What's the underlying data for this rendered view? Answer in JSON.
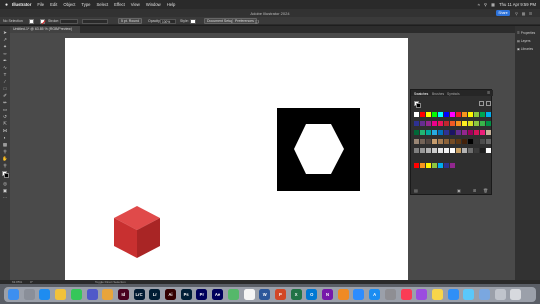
{
  "menubar": {
    "apple": "",
    "app_name": "Illustrator",
    "items": [
      "File",
      "Edit",
      "Object",
      "Type",
      "Select",
      "Effect",
      "View",
      "Window",
      "Help"
    ],
    "clock": "Thu 11 Apr 9:59 PM"
  },
  "appbar": {
    "title": "Adobe Illustrator 2024",
    "share_label": "Share"
  },
  "controlbar": {
    "selection_label": "No Selection",
    "stroke_label": "Stroke:",
    "opacity_label": "Opacity:",
    "opacity_value": "100%",
    "style_label": "Style:",
    "basic_label": "5 pt. Round",
    "doc_setup_label": "Document Setup",
    "preferences_label": "Preferences"
  },
  "document_tab": {
    "label": "Untitled-1* @ 63.85 % (RGB/Preview)"
  },
  "right_dock": {
    "items": [
      "Properties",
      "Layers",
      "Libraries"
    ]
  },
  "swatches_panel": {
    "tabs": [
      "Swatches",
      "Brushes",
      "Symbols"
    ],
    "colors": [
      [
        "#ffffff",
        "#ff0000",
        "#ffff00",
        "#00ff00",
        "#00ffff",
        "#0000ff",
        "#ff00ff",
        "#ed1c24",
        "#f7941d",
        "#fff200",
        "#8dc63f",
        "#00a651",
        "#00aeef"
      ],
      [
        "#2e3192",
        "#662d91",
        "#92278f",
        "#ec008c",
        "#ed145b",
        "#c1272d",
        "#f15a24",
        "#f7931e",
        "#fcee21",
        "#d9e021",
        "#8cc63f",
        "#39b54a",
        "#009245"
      ],
      [
        "#006837",
        "#22b573",
        "#00a99d",
        "#29abe2",
        "#0071bc",
        "#2e3192",
        "#1b1464",
        "#662d91",
        "#93278f",
        "#9e005d",
        "#d4145a",
        "#ed1e79",
        "#c7b299"
      ],
      [
        "#998675",
        "#736357",
        "#534741",
        "#c69c6d",
        "#a67c52",
        "#8c6239",
        "#754c24",
        "#603813",
        "#42210b",
        "#000000",
        "#333333",
        "#4d4d4d",
        "#666666"
      ],
      [
        "#808080",
        "#999999",
        "#b3b3b3",
        "#cccccc",
        "#e6e6e6",
        "#f2f2f2",
        "#ffffff",
        "#c8a064",
        "#b4b4b4",
        "#6e6e6e",
        "#3c3c3c",
        "#1e1e1e",
        "#ffffff"
      ]
    ],
    "bottom_colors": [
      "#ff0000",
      "#f7941d",
      "#fff200",
      "#8dc63f",
      "#00aeef",
      "#2e3192",
      "#92278f"
    ]
  },
  "artwork": {
    "cube_top": "#e04a4a",
    "cube_left": "#c83030",
    "cube_right": "#a92525",
    "black_square": "#000000",
    "hexagon_fill": "#ffffff"
  },
  "statusbar": {
    "zoom": "63.85%",
    "angle": "0°",
    "tool_label": "Toggle Direct Selection"
  },
  "dock_apps": [
    {
      "name": "finder",
      "label": "",
      "color": "#3d8ff0"
    },
    {
      "name": "launchpad",
      "label": "",
      "color": "#8a8f99"
    },
    {
      "name": "safari",
      "label": "",
      "color": "#1e8cf0"
    },
    {
      "name": "chrome",
      "label": "",
      "color": "#f2c23a"
    },
    {
      "name": "messages",
      "label": "",
      "color": "#35c759"
    },
    {
      "name": "teams",
      "label": "",
      "color": "#5059c9"
    },
    {
      "name": "photos",
      "label": "",
      "color": "#e8a43b"
    },
    {
      "name": "indesign",
      "label": "Id",
      "color": "#49021f"
    },
    {
      "name": "lightroom-classic",
      "label": "LrC",
      "color": "#001a33"
    },
    {
      "name": "lightroom",
      "label": "Lr",
      "color": "#001d34"
    },
    {
      "name": "illustrator",
      "label": "Ai",
      "color": "#330000"
    },
    {
      "name": "photoshop",
      "label": "Ps",
      "color": "#001e36"
    },
    {
      "name": "premiere",
      "label": "Pr",
      "color": "#00005b"
    },
    {
      "name": "after-effects",
      "label": "Ae",
      "color": "#00005b"
    },
    {
      "name": "maps",
      "label": "",
      "color": "#55b86a"
    },
    {
      "name": "calendar",
      "label": "",
      "color": "#f5f5f5"
    },
    {
      "name": "word",
      "label": "W",
      "color": "#2b579a"
    },
    {
      "name": "powerpoint",
      "label": "P",
      "color": "#d24726"
    },
    {
      "name": "excel",
      "label": "X",
      "color": "#217346"
    },
    {
      "name": "outlook",
      "label": "O",
      "color": "#0078d4"
    },
    {
      "name": "onenote",
      "label": "N",
      "color": "#7719aa"
    },
    {
      "name": "vlc",
      "label": "",
      "color": "#f08a24"
    },
    {
      "name": "zoom",
      "label": "",
      "color": "#2d8cff"
    },
    {
      "name": "app-store",
      "label": "A",
      "color": "#1b8df2"
    },
    {
      "name": "settings",
      "label": "",
      "color": "#8e8e93"
    },
    {
      "name": "music",
      "label": "",
      "color": "#fa3c55"
    },
    {
      "name": "podcasts",
      "label": "",
      "color": "#9b4de0"
    },
    {
      "name": "notes",
      "label": "",
      "color": "#f7d54a"
    },
    {
      "name": "mail",
      "label": "",
      "color": "#2f8ff7"
    },
    {
      "name": "maps2",
      "label": "",
      "color": "#5ac8fa"
    },
    {
      "name": "preview",
      "label": "",
      "color": "#7aa7e0"
    },
    {
      "name": "documents",
      "label": "",
      "color": "#c0c4cc"
    },
    {
      "name": "trash",
      "label": "",
      "color": "#d7d9de"
    }
  ]
}
